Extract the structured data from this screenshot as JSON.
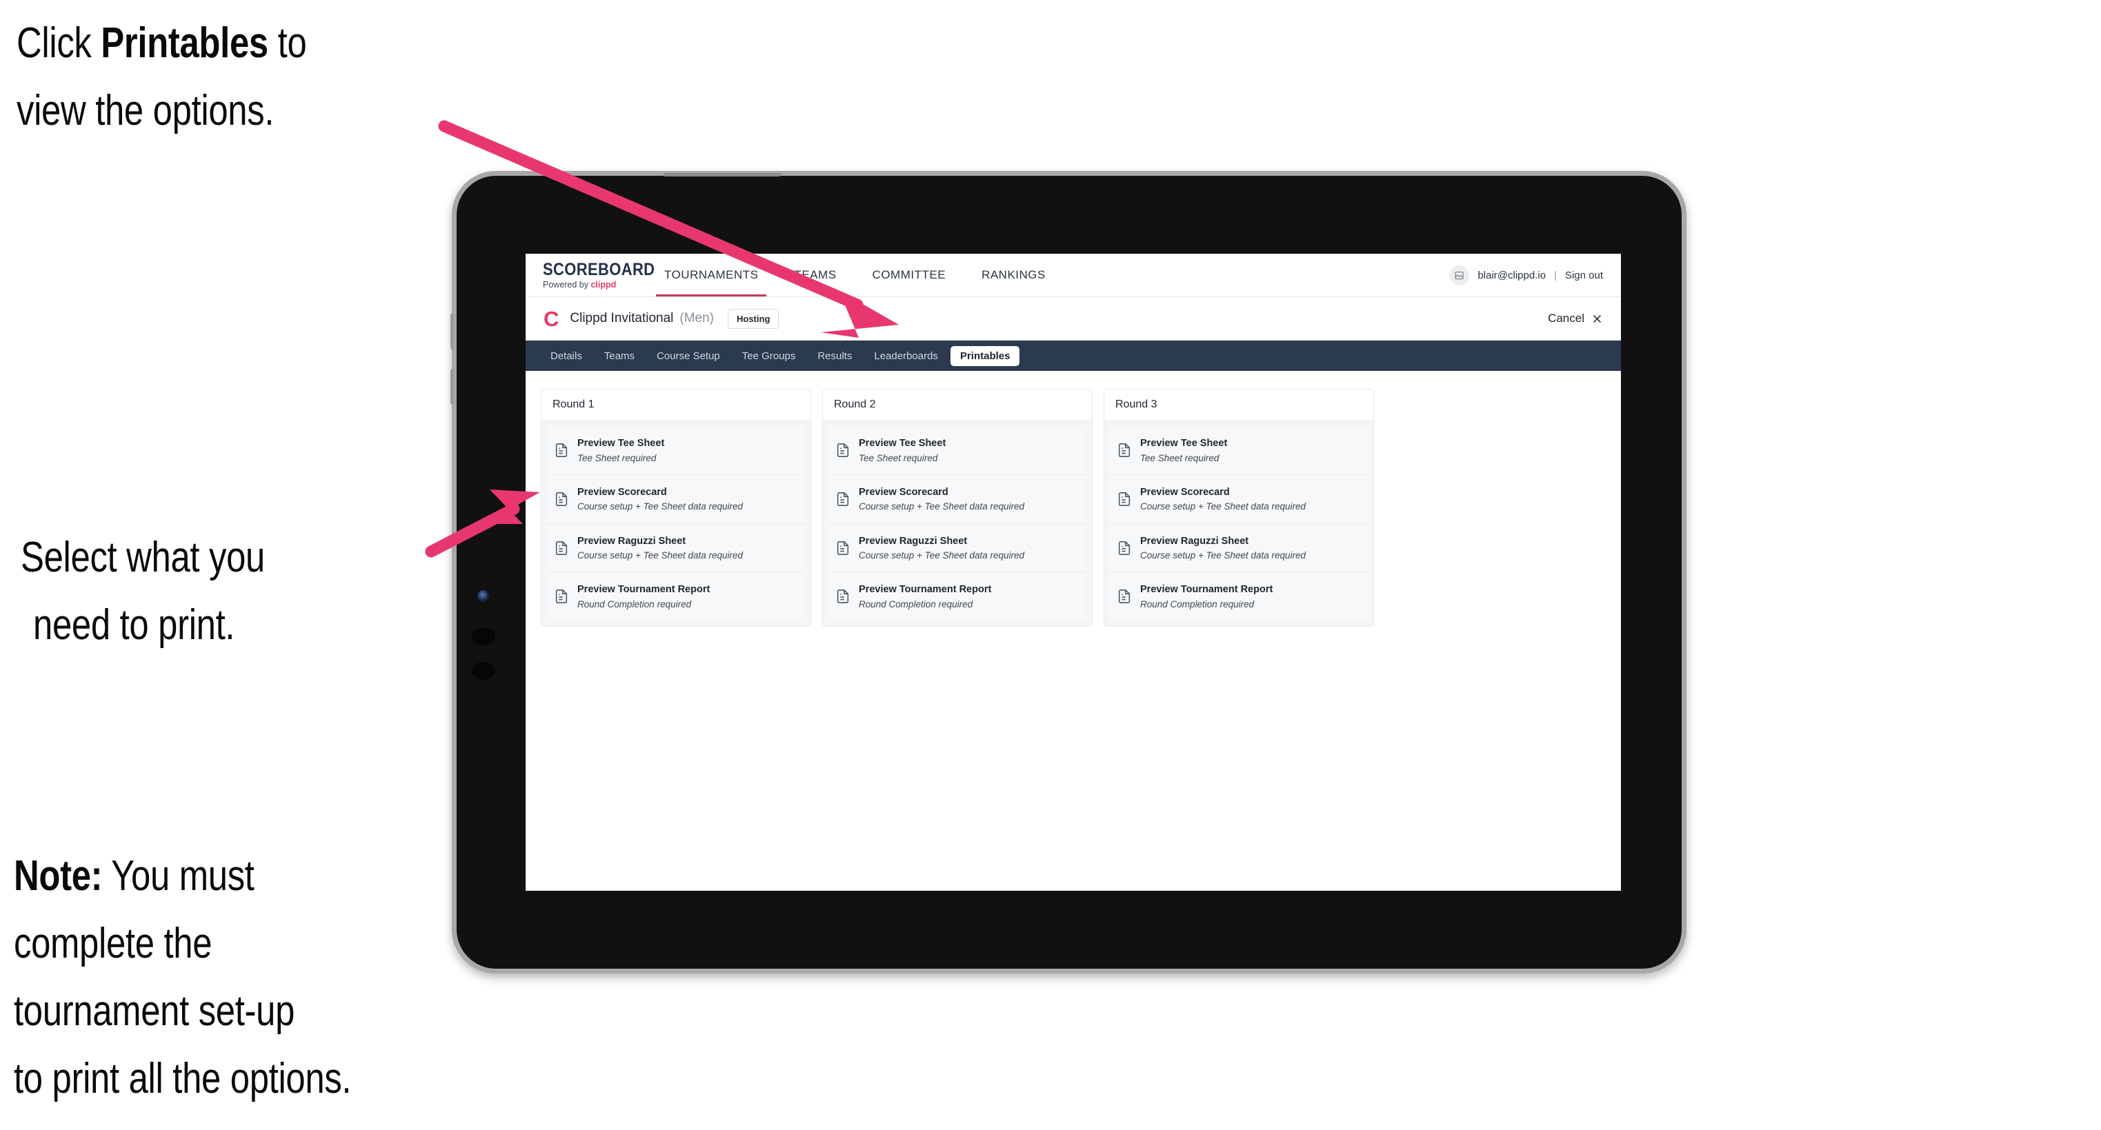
{
  "annotations": {
    "callout_1_pre": "Click ",
    "callout_1_bold": "Printables",
    "callout_1_post": " to\nview the options.",
    "callout_2_line_1": "Select what you",
    "callout_2_line_2": "need to print.",
    "callout_3_bold": "Note:",
    "callout_3_rest": " You must\ncomplete the\ntournament set-up\nto print all the options."
  },
  "colors": {
    "accent_pink": "#e8376f",
    "brand_red": "#e23b63",
    "tabbar_dark": "#2c3a4f",
    "text_dark": "#20262f"
  },
  "topbar": {
    "brand_title": "SCOREBOARD",
    "brand_sub_prefix": "Powered by ",
    "brand_sub_mark": "clippd",
    "nav": [
      {
        "label": "TOURNAMENTS",
        "active": true
      },
      {
        "label": "TEAMS",
        "active": false
      },
      {
        "label": "COMMITTEE",
        "active": false
      },
      {
        "label": "RANKINGS",
        "active": false
      }
    ],
    "avatar_icon": "user-image-icon",
    "user_email": "blair@clippd.io",
    "divider": "|",
    "sign_out_label": "Sign out"
  },
  "subheader": {
    "logo_glyph": "C",
    "tournament_name": "Clippd Invitational",
    "gender": "(Men)",
    "status_badge": "Hosting",
    "cancel_label": "Cancel",
    "cancel_icon": "close-icon"
  },
  "tabs": [
    {
      "label": "Details",
      "active": false
    },
    {
      "label": "Teams",
      "active": false
    },
    {
      "label": "Course Setup",
      "active": false
    },
    {
      "label": "Tee Groups",
      "active": false
    },
    {
      "label": "Results",
      "active": false
    },
    {
      "label": "Leaderboards",
      "active": false
    },
    {
      "label": "Printables",
      "active": true
    }
  ],
  "rounds": [
    {
      "title": "Round 1",
      "items": [
        {
          "title": "Preview Tee Sheet",
          "sub": "Tee Sheet required"
        },
        {
          "title": "Preview Scorecard",
          "sub": "Course setup + Tee Sheet data required"
        },
        {
          "title": "Preview Raguzzi Sheet",
          "sub": "Course setup + Tee Sheet data required"
        },
        {
          "title": "Preview Tournament Report",
          "sub": "Round Completion required"
        }
      ]
    },
    {
      "title": "Round 2",
      "items": [
        {
          "title": "Preview Tee Sheet",
          "sub": "Tee Sheet required"
        },
        {
          "title": "Preview Scorecard",
          "sub": "Course setup + Tee Sheet data required"
        },
        {
          "title": "Preview Raguzzi Sheet",
          "sub": "Course setup + Tee Sheet data required"
        },
        {
          "title": "Preview Tournament Report",
          "sub": "Round Completion required"
        }
      ]
    },
    {
      "title": "Round 3",
      "items": [
        {
          "title": "Preview Tee Sheet",
          "sub": "Tee Sheet required"
        },
        {
          "title": "Preview Scorecard",
          "sub": "Course setup + Tee Sheet data required"
        },
        {
          "title": "Preview Raguzzi Sheet",
          "sub": "Course setup + Tee Sheet data required"
        },
        {
          "title": "Preview Tournament Report",
          "sub": "Round Completion required"
        }
      ]
    }
  ]
}
